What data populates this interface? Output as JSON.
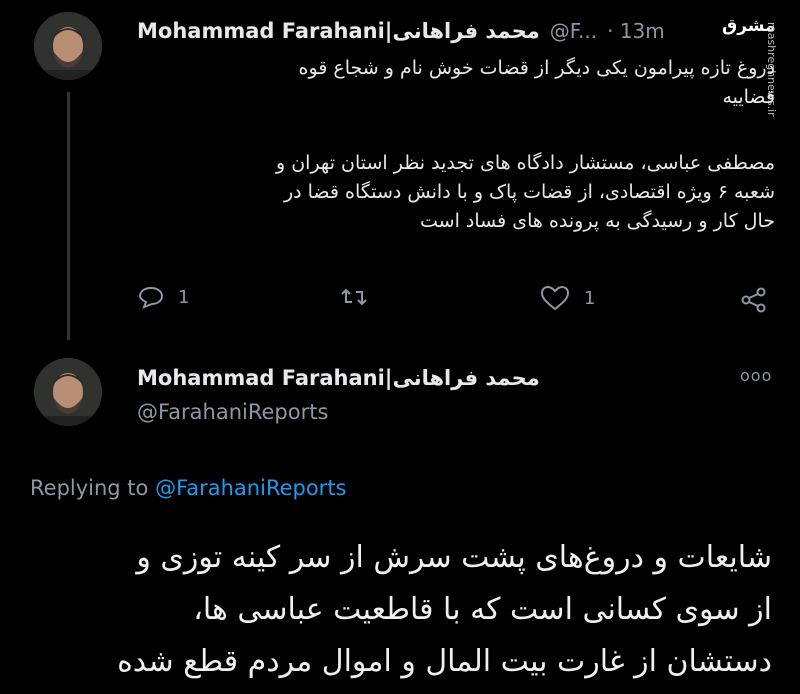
{
  "tweet1": {
    "display_name": "Mohammad Farahani|محمد فراهانی",
    "handle": "@F...",
    "time": "· 13m",
    "text_lines": [
      "دروغ تازه پیرامون یکی دیگر از قضات خوش نام و شجاع قوه",
      "قضاییه",
      "",
      "مصطفی عباسی، مستشار دادگاه های تجدید نظر استان تهران و",
      "شعبه ۶ ویژه اقتصادی، از قضات پاک و با دانش دستگاه قضا در",
      "حال کار و رسیدگی به پرونده های فساد است"
    ],
    "reply_count": "1",
    "like_count": "1"
  },
  "tweet2": {
    "display_name": "Mohammad Farahani|محمد فراهانی",
    "handle": "@FarahaniReports",
    "more": "ooo",
    "replying_prefix": "Replying to",
    "replying_handle": "@FarahaniReports",
    "text_lines": [
      "شایعات و دروغ‌های پشت سرش از سر کینه توزی و",
      "از سوی کسانی است که با قاطعیت عباسی ها،",
      "دستشان از غارت بیت المال و اموال مردم قطع شده"
    ]
  },
  "watermark": {
    "logo": "مشرق",
    "site": "mashreghnews.ir"
  }
}
